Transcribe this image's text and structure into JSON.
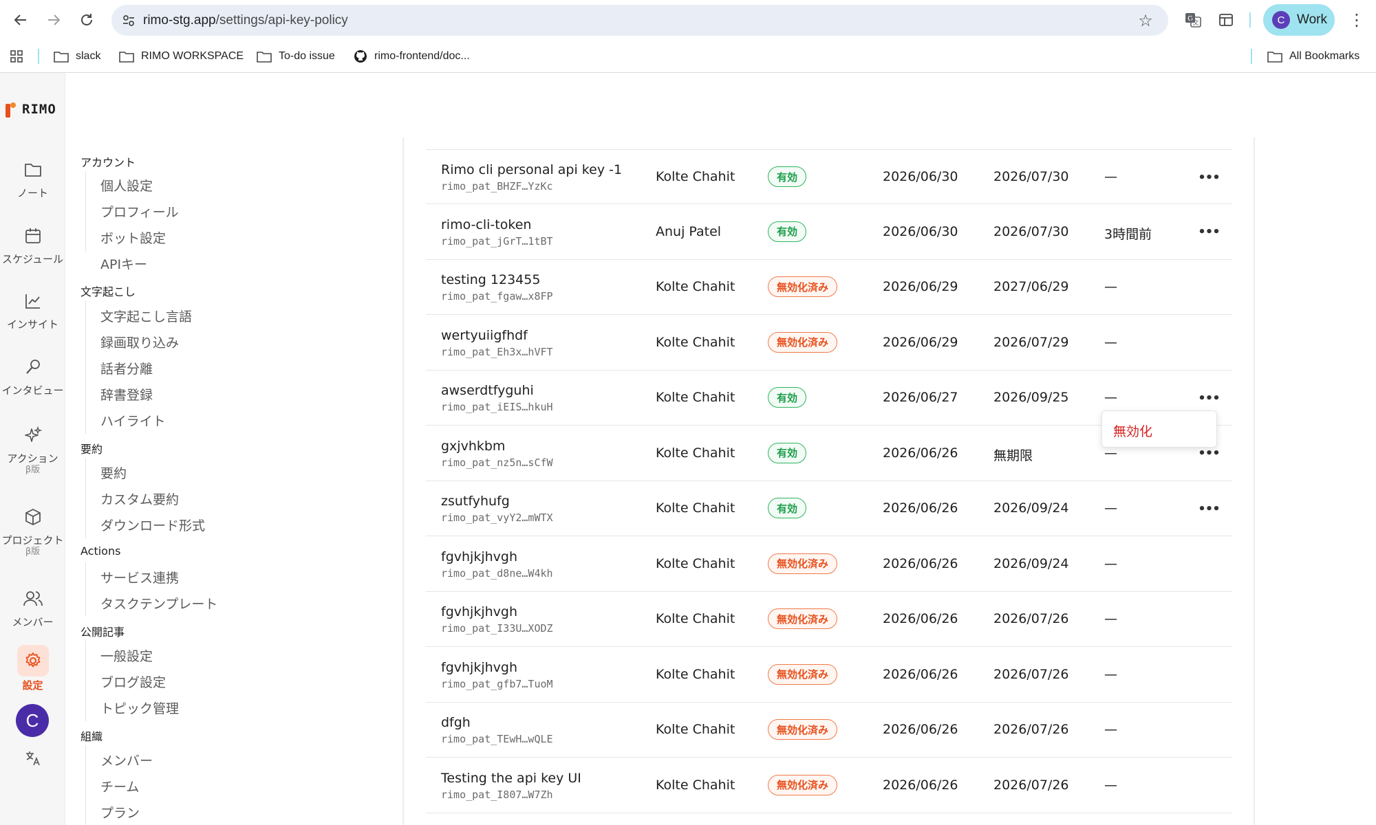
{
  "browser": {
    "url_host": "rimo-stg.app",
    "url_path": "/settings/api-key-policy",
    "profile_initial": "C",
    "profile_label": "Work",
    "bookmarks": [
      "slack",
      "RIMO WORKSPACE",
      "To-do issue",
      "rimo-frontend/doc...",
      "All Bookmarks"
    ]
  },
  "app": {
    "logo_text": "RIMO",
    "accent": "#e8501c",
    "rail": [
      {
        "label": "ノート",
        "sub": "",
        "icon": "folder-icon"
      },
      {
        "label": "スケジュール",
        "sub": "",
        "icon": "calendar-icon"
      },
      {
        "label": "インサイト",
        "sub": "",
        "icon": "chart-icon"
      },
      {
        "label": "インタビュー",
        "sub": "",
        "icon": "microphone-icon"
      },
      {
        "label": "アクション",
        "sub": "β版",
        "icon": "sparkle-icon"
      },
      {
        "label": "プロジェクト",
        "sub": "β版",
        "icon": "box-icon"
      },
      {
        "label": "メンバー",
        "sub": "",
        "icon": "people-icon"
      },
      {
        "label": "設定",
        "sub": "",
        "icon": "gear-icon"
      }
    ],
    "avatar_initial": "C"
  },
  "settings_nav": {
    "groups": [
      {
        "title": "アカウント",
        "items": [
          "個人設定",
          "プロフィール",
          "ボット設定",
          "APIキー"
        ]
      },
      {
        "title": "文字起こし",
        "items": [
          "文字起こし言語",
          "録画取り込み",
          "話者分離",
          "辞書登録",
          "ハイライト"
        ]
      },
      {
        "title": "要約",
        "items": [
          "要約",
          "カスタム要約",
          "ダウンロード形式"
        ]
      },
      {
        "title": "Actions",
        "items": [
          "サービス連携",
          "タスクテンプレート"
        ]
      },
      {
        "title": "公開記事",
        "items": [
          "一般設定",
          "ブログ設定",
          "トピック管理"
        ]
      },
      {
        "title": "組織",
        "items": [
          "メンバー",
          "チーム",
          "プラン"
        ]
      }
    ]
  },
  "api_keys": {
    "rows": [
      {
        "name": "Rimo cli personal api key -1",
        "token": "rimo_pat_BHZF…YzKc",
        "owner": "Kolte Chahit",
        "status": "有効",
        "status_type": "active",
        "created": "2026/06/30",
        "expires": "2026/07/30",
        "last_used": "—",
        "has_menu": true
      },
      {
        "name": "rimo-cli-token",
        "token": "rimo_pat_jGrT…1tBT",
        "owner": "Anuj Patel",
        "status": "有効",
        "status_type": "active",
        "created": "2026/06/30",
        "expires": "2026/07/30",
        "last_used": "3時間前",
        "has_menu": true
      },
      {
        "name": "testing 123455",
        "token": "rimo_pat_fgaw…x8FP",
        "owner": "Kolte Chahit",
        "status": "無効化済み",
        "status_type": "revoked",
        "created": "2026/06/29",
        "expires": "2027/06/29",
        "last_used": "—",
        "has_menu": false
      },
      {
        "name": "wertyuiigfhdf",
        "token": "rimo_pat_Eh3x…hVFT",
        "owner": "Kolte Chahit",
        "status": "無効化済み",
        "status_type": "revoked",
        "created": "2026/06/29",
        "expires": "2026/07/29",
        "last_used": "—",
        "has_menu": false
      },
      {
        "name": "awserdtfyguhi",
        "token": "rimo_pat_iEIS…hkuH",
        "owner": "Kolte Chahit",
        "status": "有効",
        "status_type": "active",
        "created": "2026/06/27",
        "expires": "2026/09/25",
        "last_used": "—",
        "has_menu": true
      },
      {
        "name": "gxjvhkbm",
        "token": "rimo_pat_nz5n…sCfW",
        "owner": "Kolte Chahit",
        "status": "有効",
        "status_type": "active",
        "created": "2026/06/26",
        "expires": "無期限",
        "last_used": "—",
        "has_menu": true
      },
      {
        "name": "zsutfyhufg",
        "token": "rimo_pat_vyY2…mWTX",
        "owner": "Kolte Chahit",
        "status": "有効",
        "status_type": "active",
        "created": "2026/06/26",
        "expires": "2026/09/24",
        "last_used": "—",
        "has_menu": true
      },
      {
        "name": "fgvhjkjhvgh",
        "token": "rimo_pat_d8ne…W4kh",
        "owner": "Kolte Chahit",
        "status": "無効化済み",
        "status_type": "revoked",
        "created": "2026/06/26",
        "expires": "2026/09/24",
        "last_used": "—",
        "has_menu": false
      },
      {
        "name": "fgvhjkjhvgh",
        "token": "rimo_pat_I33U…XODZ",
        "owner": "Kolte Chahit",
        "status": "無効化済み",
        "status_type": "revoked",
        "created": "2026/06/26",
        "expires": "2026/07/26",
        "last_used": "—",
        "has_menu": false
      },
      {
        "name": "fgvhjkjhvgh",
        "token": "rimo_pat_gfb7…TuoM",
        "owner": "Kolte Chahit",
        "status": "無効化済み",
        "status_type": "revoked",
        "created": "2026/06/26",
        "expires": "2026/07/26",
        "last_used": "—",
        "has_menu": false
      },
      {
        "name": "dfgh",
        "token": "rimo_pat_TEwH…wQLE",
        "owner": "Kolte Chahit",
        "status": "無効化済み",
        "status_type": "revoked",
        "created": "2026/06/26",
        "expires": "2026/07/26",
        "last_used": "—",
        "has_menu": false
      },
      {
        "name": "Testing the api key UI",
        "token": "rimo_pat_I807…W7Zh",
        "owner": "Kolte Chahit",
        "status": "無効化済み",
        "status_type": "revoked",
        "created": "2026/06/26",
        "expires": "2026/07/26",
        "last_used": "—",
        "has_menu": false
      }
    ],
    "popup_menu": {
      "label": "無効化"
    }
  }
}
